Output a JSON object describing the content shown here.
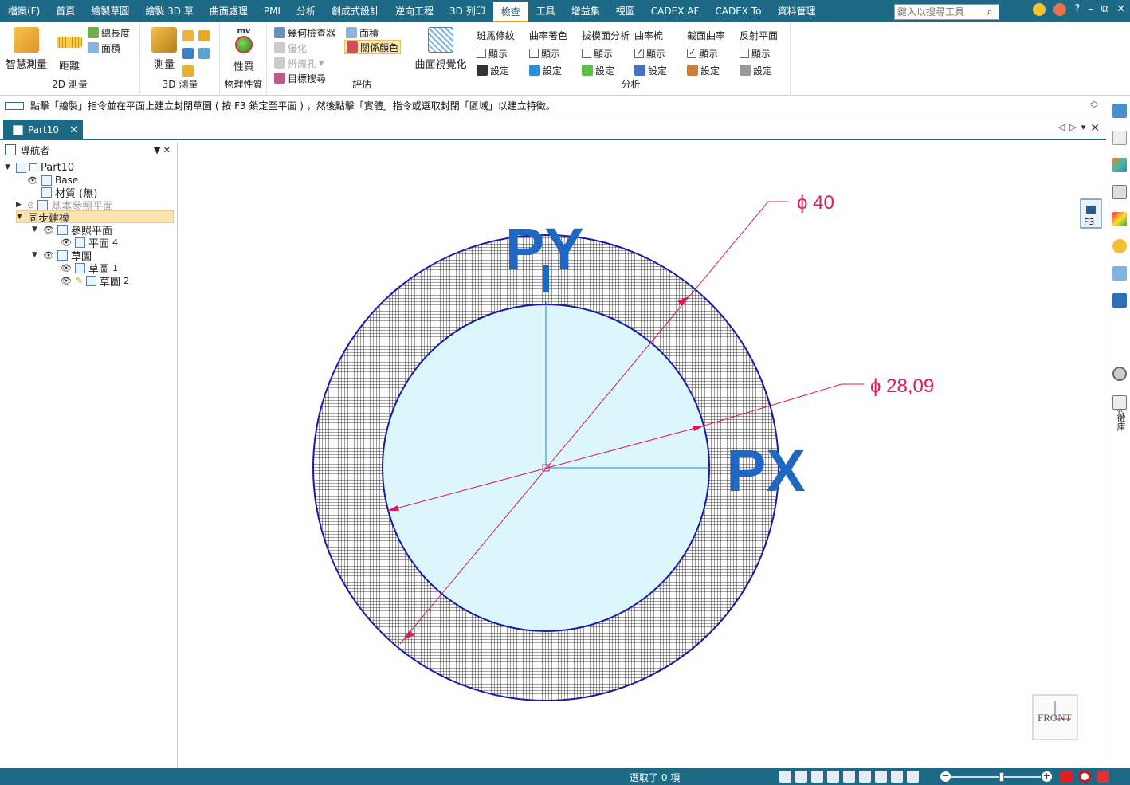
{
  "menu": {
    "tabs": [
      "檔案(F)",
      "首頁",
      "繪製草圖",
      "繪製 3D 草",
      "曲面處理",
      "PMI",
      "分析",
      "創成式設計",
      "逆向工程",
      "3D 列印",
      "檢查",
      "工具",
      "增益集",
      "視圖",
      "CADEX AF",
      "CADEX To",
      "資料管理"
    ],
    "active_tab": "檢查",
    "search_placeholder": "鍵入以搜尋工具",
    "search_icon": "magnifier-icon",
    "window_controls": [
      "?",
      "–",
      "⧉",
      "✕"
    ]
  },
  "ribbon": {
    "measure2d": {
      "smart_label": "智慧測量",
      "distance_label": "距離",
      "total_length_label": "總長度",
      "area_label": "面積",
      "group_label": "2D 測量"
    },
    "measure3d": {
      "measure_label": "測量",
      "group_label": "3D 測量"
    },
    "physical": {
      "icon_text": "mv",
      "property_label": "性質",
      "group_label": "物理性質"
    },
    "evaluate": {
      "geometry_inspector": "幾何檢查器",
      "area": "面積",
      "optimize": "優化",
      "relation_color": "關係顏色",
      "identify_hole": "辨識孔",
      "target_search": "目標搜尋",
      "group_label": "評估"
    },
    "surface_visual": {
      "label": "曲面視覺化"
    },
    "analysis": {
      "group_label": "分析",
      "columns": [
        {
          "header": "斑馬條紋",
          "show": "顯示",
          "show_checked": false,
          "setting": "設定"
        },
        {
          "header": "曲率著色",
          "show": "顯示",
          "show_checked": false,
          "setting": "設定"
        },
        {
          "header": "拔模面分析",
          "show": "顯示",
          "show_checked": false,
          "setting": "設定"
        },
        {
          "header": "曲率梳",
          "show": "顯示",
          "show_checked": true,
          "setting": "設定"
        },
        {
          "header": "截面曲率",
          "show": "顯示",
          "show_checked": true,
          "setting": "設定"
        },
        {
          "header": "反射平面",
          "show": "顯示",
          "show_checked": false,
          "setting": "設定"
        }
      ]
    }
  },
  "prompt": {
    "text": "點擊「繪製」指令並在平面上建立封閉草圖 ( 按 F3 鎖定至平面 ) ，然後點擊「實體」指令或選取封閉「區域」以建立特徵。"
  },
  "document": {
    "tab_label": "Part10"
  },
  "navigator": {
    "title": "導航者",
    "items": [
      {
        "label": "Part10",
        "level": 0
      },
      {
        "label": "Base",
        "level": 1
      },
      {
        "label": "材質 (無)",
        "level": 1
      },
      {
        "label": "基本參照平面",
        "level": 1
      },
      {
        "label": "同步建模",
        "level": 0
      },
      {
        "label": "參照平面",
        "level": 1
      },
      {
        "label": "平面",
        "suffix": "4",
        "level": 2
      },
      {
        "label": "草圖",
        "level": 1
      },
      {
        "label": "草圖",
        "suffix": "1",
        "level": 2
      },
      {
        "label": "草圖",
        "suffix": "2",
        "level": 2
      }
    ]
  },
  "canvas": {
    "dim_outer": "ϕ 40",
    "dim_inner": "ϕ 28,09",
    "axis_py": "PY",
    "axis_px": "PX",
    "view_cube_label": "FRONT",
    "lock_label": "F3",
    "colors": {
      "circle_stroke": "#1a1aa8",
      "ring_fill": "#3a3a3a",
      "inner_fill": "#dcf7fb",
      "dimension": "#e0185c",
      "axis_text": "#1f67c4",
      "axis_line": "#2a7fd6"
    }
  },
  "rightdock": {
    "vertical_label": "特徵庫",
    "icons": [
      "ribbon-icon",
      "help-icon",
      "palette-icon",
      "layers-icon",
      "color-icon",
      "key-icon",
      "view-icon",
      "feature-library-icon",
      "settings-icon",
      "graph-icon"
    ]
  },
  "status": {
    "text": "選取了 0 項",
    "zoom_minus": "−",
    "zoom_plus": "+"
  }
}
